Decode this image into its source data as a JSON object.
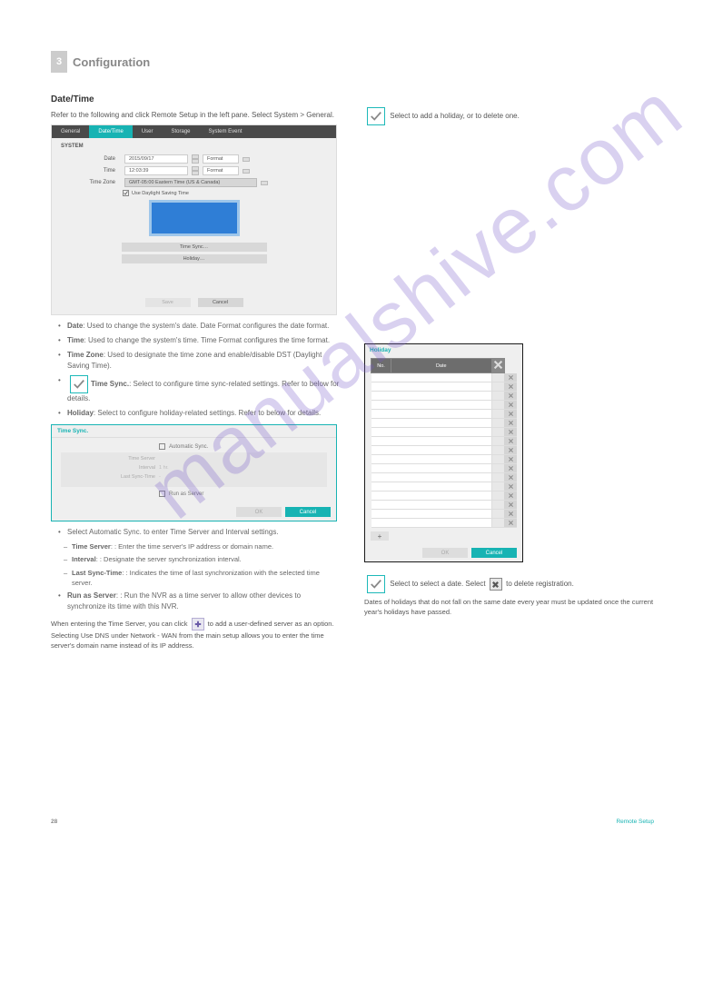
{
  "header": {
    "num": "3",
    "title": "Configuration"
  },
  "section": "Date/Time",
  "intro": "Refer to the following and click Remote Setup in the left pane. Select System > General.",
  "ss1": {
    "tabs": [
      "General",
      "Date/Time",
      "User",
      "Storage",
      "System Event"
    ],
    "panelTitle": "SYSTEM",
    "dateLabel": "Date",
    "dateValue": "2015/09/17",
    "formatLabel": "Format",
    "timeLabel": "Time",
    "timeValue": "12:03:39",
    "tzLabel": "Time Zone",
    "tzValue": "GMT-05:00  Eastern Time (US & Canada)",
    "dstLabel": "Use Daylight Saving Time",
    "timeSyncBtn": "Time Sync…",
    "holidayBtn": "Holiday…",
    "saveBtn": "Save",
    "cancelBtn": "Cancel"
  },
  "bullets1": [
    {
      "label": "Date",
      "text": ": Used to change the system's date. Date Format configures the date format."
    },
    {
      "label": "Time",
      "text": ": Used to change the system's time. Time Format configures the time format."
    },
    {
      "label": "Time Zone",
      "text": ": Used to designate the time zone and enable/disable DST (Daylight Saving Time)."
    },
    {
      "label": "Time Sync.",
      "text": ": Select to configure time sync-related settings. Refer to below for details."
    },
    {
      "label": "Holiday",
      "text": ": Select to configure holiday-related settings. Refer to below for details."
    }
  ],
  "ss2": {
    "title": "Time Sync.",
    "autoLabel": "Automatic Sync.",
    "tsLabel": "Time Server",
    "intLabel": "Interval",
    "intVal": "1 hr.",
    "lastLabel": "Last Sync-Time",
    "runLabel": "Run as Server",
    "okBtn": "OK",
    "cancelBtn": "Cancel"
  },
  "bullets2": [
    {
      "text": "Select Automatic Sync. to enter Time Server and Interval settings."
    },
    {
      "label": "Time Server",
      "text": ": Enter the time server's IP address or domain name."
    },
    {
      "label": "Interval",
      "text": ": Designate the server synchronization interval."
    },
    {
      "label": "Last Sync-Time",
      "text": ": Indicates the time of last synchronization with the selected time server."
    },
    {
      "label": "Run as Server",
      "text": ": Run the NVR as a time server to allow other devices to synchronize its time with this NVR."
    },
    {
      "note": "When entering the Time Server, you can click ",
      "noteAfter": " to add a user-defined server as an option. Selecting Use DNS under Network - WAN from the main setup allows you to enter the time server's domain name instead of its IP address."
    }
  ],
  "right": {
    "holidayIntro": "Select   to add a holiday, or   to delete one.",
    "holidayPanelTitle": "Holiday",
    "tableHeaders": {
      "no": "No.",
      "date": "Date"
    },
    "okBtn": "OK",
    "cancelBtn": "Cancel",
    "holidayNote1": "Select ",
    "holidayNote1b": " to select a date. Select ",
    "holidayNote1c": " to delete registration.",
    "holidayNote2": "Dates of holidays that do not fall on the same date every year must be updated once the current year's holidays have passed."
  },
  "footer": {
    "page": "28",
    "right": "Remote Setup"
  }
}
